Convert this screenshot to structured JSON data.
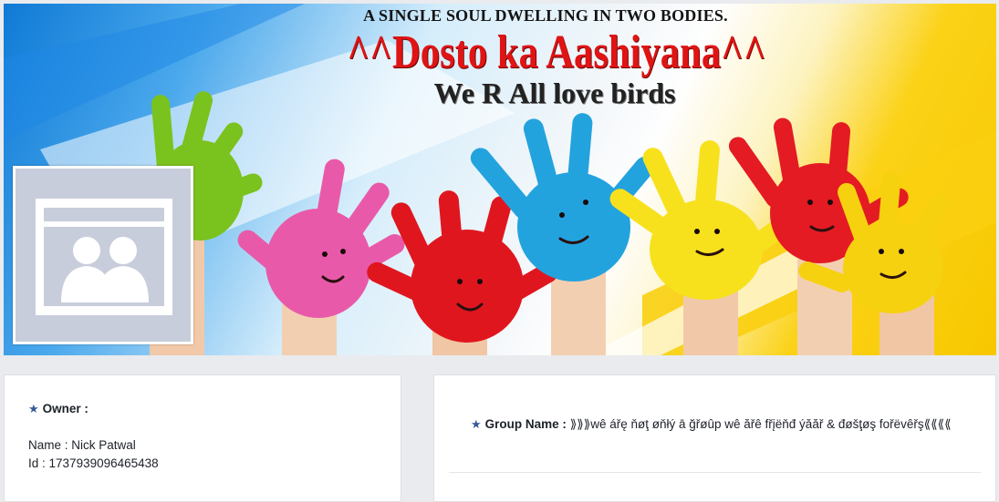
{
  "cover": {
    "tagline": "A SINGLE SOUL DWELLING IN TWO BODIES.",
    "title": "^^Dosto ka Aashiyana^^",
    "subtitle": "We R All love birds"
  },
  "profile": {
    "placeholder_icon": "group-placeholder-icon"
  },
  "owner_card": {
    "heading": "Owner :",
    "name_label": "Name :",
    "name_value": "Nick Patwal",
    "id_label": "Id :",
    "id_value": "1737939096465438"
  },
  "group_card": {
    "label": "Group Name :",
    "value": "⟫⟫⟫wê ářę ňøţ øňłý ā ğřøûp wê ăřê fřįëňđ ýăăř & đøšţøş fořëvêřş⟪⟪⟪⟪"
  },
  "colors": {
    "background": "#e9ebee",
    "accent_star": "#365899",
    "title_red": "#e01414",
    "placeholder_gray": "#c8cddb"
  }
}
